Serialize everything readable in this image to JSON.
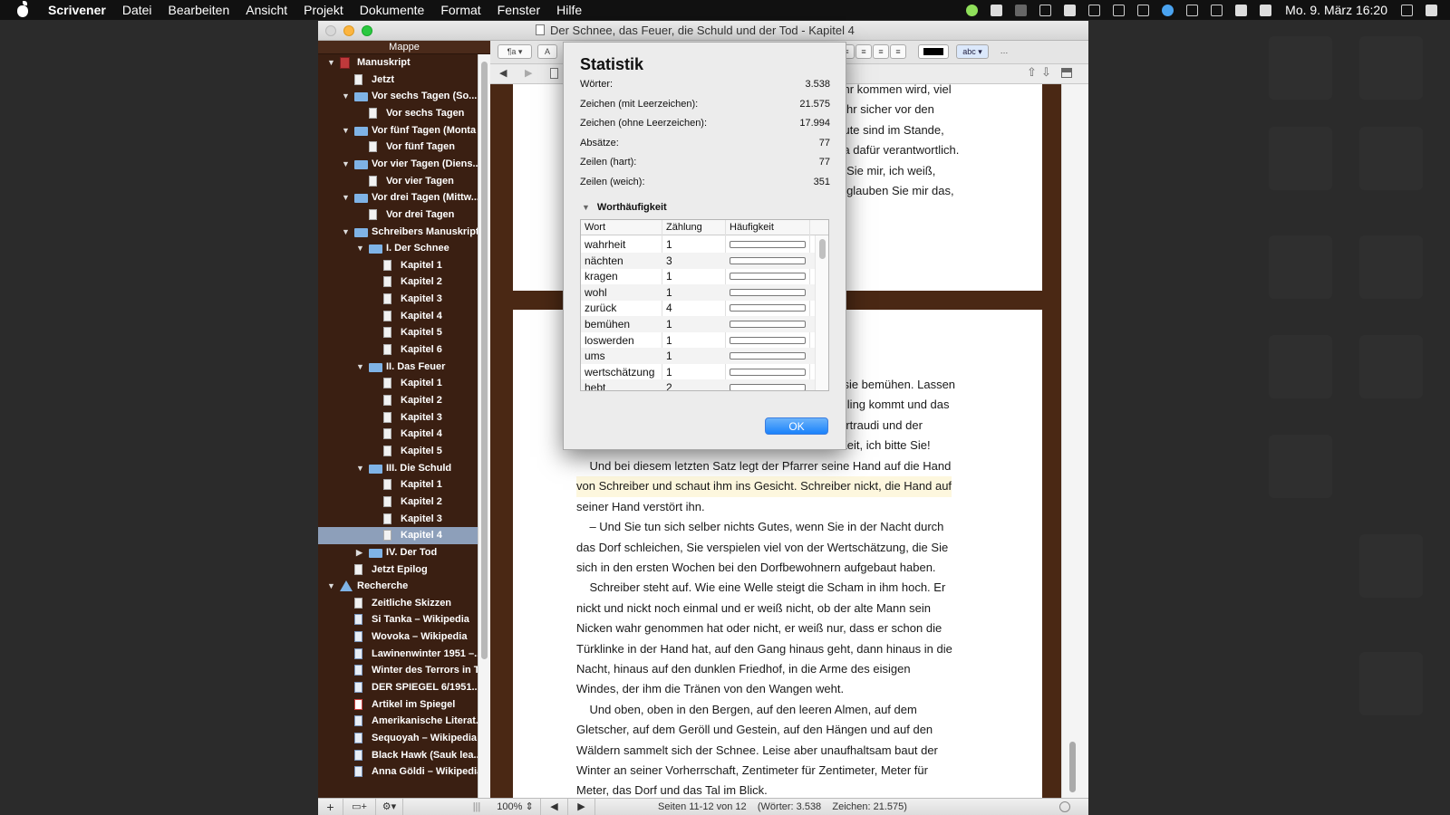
{
  "menubar": {
    "app_name": "Scrivener",
    "items": [
      "Datei",
      "Bearbeiten",
      "Ansicht",
      "Projekt",
      "Dokumente",
      "Format",
      "Fenster",
      "Hilfe"
    ],
    "clock": "Mo. 9. März  16:20"
  },
  "window": {
    "title": "Der Schnee, das Feuer, die Schuld und der Tod - Kapitel 4"
  },
  "binder": {
    "header": "Mappe",
    "items": [
      {
        "label": "Manuskript",
        "level": 0,
        "icon": "book-icon",
        "expanded": true
      },
      {
        "label": "Jetzt",
        "level": 1,
        "icon": "document-icon"
      },
      {
        "label": "Vor sechs Tagen (So...",
        "level": 1,
        "icon": "folder-icon",
        "expanded": true
      },
      {
        "label": "Vor sechs Tagen",
        "level": 2,
        "icon": "document-icon"
      },
      {
        "label": "Vor fünf Tagen (Monta",
        "level": 1,
        "icon": "folder-icon",
        "expanded": true
      },
      {
        "label": "Vor fünf Tagen",
        "level": 2,
        "icon": "document-icon"
      },
      {
        "label": "Vor vier Tagen (Diens...",
        "level": 1,
        "icon": "folder-icon",
        "expanded": true
      },
      {
        "label": "Vor vier Tagen",
        "level": 2,
        "icon": "document-icon"
      },
      {
        "label": "Vor drei Tagen (Mittw...",
        "level": 1,
        "icon": "folder-icon",
        "expanded": true
      },
      {
        "label": "Vor drei Tagen",
        "level": 2,
        "icon": "document-icon"
      },
      {
        "label": "Schreibers Manuskript",
        "level": 1,
        "icon": "folder-icon",
        "expanded": true
      },
      {
        "label": "I. Der Schnee",
        "level": 2,
        "icon": "folder-icon",
        "expanded": true
      },
      {
        "label": "Kapitel 1",
        "level": 3,
        "icon": "document-icon"
      },
      {
        "label": "Kapitel 2",
        "level": 3,
        "icon": "document-icon"
      },
      {
        "label": "Kapitel 3",
        "level": 3,
        "icon": "document-icon"
      },
      {
        "label": "Kapitel 4",
        "level": 3,
        "icon": "document-icon"
      },
      {
        "label": "Kapitel 5",
        "level": 3,
        "icon": "document-icon"
      },
      {
        "label": "Kapitel 6",
        "level": 3,
        "icon": "document-icon"
      },
      {
        "label": "II. Das Feuer",
        "level": 2,
        "icon": "folder-icon",
        "expanded": true
      },
      {
        "label": "Kapitel 1",
        "level": 3,
        "icon": "document-icon"
      },
      {
        "label": "Kapitel 2",
        "level": 3,
        "icon": "document-icon"
      },
      {
        "label": "Kapitel 3",
        "level": 3,
        "icon": "document-icon"
      },
      {
        "label": "Kapitel 4",
        "level": 3,
        "icon": "document-icon"
      },
      {
        "label": "Kapitel 5",
        "level": 3,
        "icon": "document-icon"
      },
      {
        "label": "III. Die Schuld",
        "level": 2,
        "icon": "folder-icon",
        "expanded": true
      },
      {
        "label": "Kapitel 1",
        "level": 3,
        "icon": "document-icon"
      },
      {
        "label": "Kapitel 2",
        "level": 3,
        "icon": "document-icon"
      },
      {
        "label": "Kapitel 3",
        "level": 3,
        "icon": "document-icon"
      },
      {
        "label": "Kapitel 4",
        "level": 3,
        "icon": "document-icon",
        "selected": true
      },
      {
        "label": "IV. Der Tod",
        "level": 2,
        "icon": "folder-icon",
        "expanded": false
      },
      {
        "label": "Jetzt Epilog",
        "level": 1,
        "icon": "document-icon"
      },
      {
        "label": "Recherche",
        "level": 0,
        "icon": "research-icon",
        "expanded": true
      },
      {
        "label": "Zeitliche Skizzen",
        "level": 1,
        "icon": "document-icon"
      },
      {
        "label": "Si Tanka – Wikipedia",
        "level": 1,
        "icon": "webpage-icon"
      },
      {
        "label": "Wovoka – Wikipedia",
        "level": 1,
        "icon": "webpage-icon"
      },
      {
        "label": "Lawinenwinter 1951 –...",
        "level": 1,
        "icon": "webpage-icon"
      },
      {
        "label": "Winter des Terrors in T...",
        "level": 1,
        "icon": "webpage-icon"
      },
      {
        "label": "DER SPIEGEL 6/1951...",
        "level": 1,
        "icon": "webpage-icon"
      },
      {
        "label": "Artikel im Spiegel",
        "level": 1,
        "icon": "pdf-icon"
      },
      {
        "label": "Amerikanische Literat...",
        "level": 1,
        "icon": "webpage-icon"
      },
      {
        "label": "Sequoyah – Wikipedia",
        "level": 1,
        "icon": "webpage-icon"
      },
      {
        "label": "Black Hawk (Sauk lea...",
        "level": 1,
        "icon": "webpage-icon"
      },
      {
        "label": "Anna Göldi – Wikipedia",
        "level": 1,
        "icon": "webpage-icon"
      }
    ]
  },
  "toolbar": {
    "style_label": "¶a",
    "font_label": "A",
    "highlight_label": "abc"
  },
  "editor": {
    "page1_lines": [
      "nehr kommen wird, viel",
      "mehr sicher vor den",
      "Leute sind im Stande,",
      "aria dafür verantwortlich.",
      "en Sie mir, ich weiß,",
      "te, glauben Sie mir das,"
    ],
    "page2_partial_lines": [
      "m sie bemühen. Lassen",
      "rühling kommt und das",
      "Gertraudi und der",
      "n Zeit, ich bitte Sie!"
    ],
    "page2_lines": [
      "    Und bei diesem letzten Satz legt der Pfarrer seine Hand auf die Hand",
      "von Schreiber und schaut ihm ins Gesicht. Schreiber nickt, die Hand auf",
      "seiner Hand verstört ihn.",
      "    – Und Sie tun sich selber nichts Gutes, wenn Sie in der Nacht durch",
      "das Dorf schleichen, Sie verspielen viel von der Wertschätzung, die Sie",
      "sich in den ersten Wochen bei den Dorfbewohnern aufgebaut haben.",
      "    Schreiber steht auf. Wie eine Welle steigt die Scham in ihm hoch. Er",
      "nickt und nickt noch einmal und er weiß nicht, ob der alte Mann sein",
      "Nicken wahr genommen hat oder nicht, er weiß nur, dass er schon die",
      "Türklinke in der Hand hat, auf den Gang hinaus geht, dann hinaus in die",
      "Nacht, hinaus auf den dunklen Friedhof, in die Arme des eisigen",
      "Windes, der ihm die Tränen von den Wangen weht.",
      "    Und oben, oben in den Bergen, auf den leeren Almen, auf dem",
      "Gletscher, auf dem Geröll und Gestein, auf den Hängen und auf den",
      "Wäldern sammelt sich der Schnee. Leise aber unaufhaltsam baut der",
      "Winter an seiner Vorherrschaft, Zentimeter für Zentimeter, Meter für",
      "Meter, das Dorf und das Tal im Blick."
    ]
  },
  "footer": {
    "zoom": "100%",
    "status": "Seiten 11-12 von 12    (Wörter: 3.538    Zeichen: 21.575)"
  },
  "dialog": {
    "title": "Statistik",
    "stats": [
      {
        "label": "Wörter:",
        "value": "3.538"
      },
      {
        "label": "Zeichen (mit Leerzeichen):",
        "value": "21.575"
      },
      {
        "label": "Zeichen (ohne Leerzeichen):",
        "value": "17.994"
      },
      {
        "label": "Absätze:",
        "value": "77"
      },
      {
        "label": "Zeilen (hart):",
        "value": "77"
      },
      {
        "label": "Zeilen (weich):",
        "value": "351"
      }
    ],
    "word_freq_title": "Worthäufigkeit",
    "columns": [
      "Wort",
      "Zählung",
      "Häufigkeit"
    ],
    "words": [
      {
        "word": "wahrheit",
        "count": "1",
        "freq": 0.0
      },
      {
        "word": "nächten",
        "count": "3",
        "freq": 0.0
      },
      {
        "word": "kragen",
        "count": "1",
        "freq": 0.0
      },
      {
        "word": "wohl",
        "count": "1",
        "freq": 0.0
      },
      {
        "word": "zurück",
        "count": "4",
        "freq": 0.0
      },
      {
        "word": "bemühen",
        "count": "1",
        "freq": 0.0
      },
      {
        "word": "loswerden",
        "count": "1",
        "freq": 0.0
      },
      {
        "word": "ums",
        "count": "1",
        "freq": 0.0
      },
      {
        "word": "wertschätzung",
        "count": "1",
        "freq": 0.0
      },
      {
        "word": "hebt",
        "count": "2",
        "freq": 0.0
      }
    ],
    "ok_label": "OK"
  },
  "colors": {
    "sidebar_bg": "#3a1f12",
    "selection": "#8d9fba",
    "accent_blue": "#1a82fb",
    "desk_wood": "#4a2814"
  }
}
